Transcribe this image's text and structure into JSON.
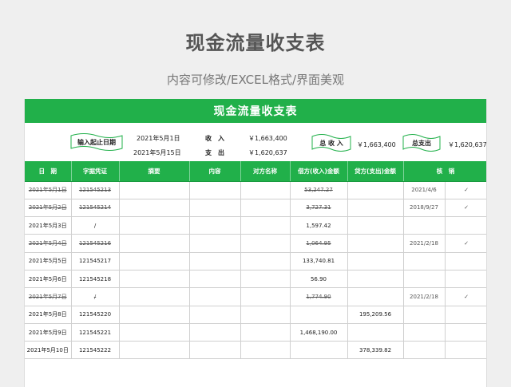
{
  "page": {
    "title": "现金流量收支表",
    "subtitle": "内容可修改/EXCEL格式/界面美观"
  },
  "sheet": {
    "title": "现金流量收支表",
    "summary": {
      "period_label": "输入起止日期",
      "start_date": "2021年5月1日",
      "end_date": "2021年5月15日",
      "income_label": "收　入",
      "expense_label": "支　出",
      "income_value": "￥1,663,400",
      "expense_value": "￥1,620,637",
      "total_income_label": "总 收 入",
      "total_income_value": "￥1,663,400",
      "total_expense_label": "总支出",
      "total_expense_value": "￥1,620,637"
    },
    "columns": [
      "日　期",
      "字据凭证",
      "摘要",
      "内容",
      "对方名称",
      "借方(收入)金额",
      "贷方(支出)金额",
      "核　销"
    ],
    "rows": [
      {
        "date": "2021年5月1日",
        "voucher": "121545213",
        "debit": "53,247.27",
        "credit": "",
        "verify_date": "2021/4/6",
        "check": "✓",
        "done": true
      },
      {
        "date": "2021年5月2日",
        "voucher": "121545214",
        "debit": "3,727.31",
        "credit": "",
        "verify_date": "2018/9/27",
        "check": "✓",
        "done": true
      },
      {
        "date": "2021年5月3日",
        "voucher": "/",
        "debit": "1,597.42",
        "credit": "",
        "verify_date": "",
        "check": "",
        "done": false
      },
      {
        "date": "2021年5月4日",
        "voucher": "121545216",
        "debit": "1,064.95",
        "credit": "",
        "verify_date": "2021/2/18",
        "check": "✓",
        "done": true
      },
      {
        "date": "2021年5月5日",
        "voucher": "121545217",
        "debit": "133,740.81",
        "credit": "",
        "verify_date": "",
        "check": "",
        "done": false
      },
      {
        "date": "2021年5月6日",
        "voucher": "121545218",
        "debit": "56.90",
        "credit": "",
        "verify_date": "",
        "check": "",
        "done": false
      },
      {
        "date": "2021年5月7日",
        "voucher": "/",
        "debit": "1,774.90",
        "credit": "",
        "verify_date": "2021/2/18",
        "check": "✓",
        "done": true
      },
      {
        "date": "2021年5月8日",
        "voucher": "121545220",
        "debit": "",
        "credit": "195,209.56",
        "verify_date": "",
        "check": "",
        "done": false
      },
      {
        "date": "2021年5月9日",
        "voucher": "121545221",
        "debit": "1,468,190.00",
        "credit": "",
        "verify_date": "",
        "check": "",
        "done": false
      },
      {
        "date": "2021年5月10日",
        "voucher": "121545222",
        "debit": "",
        "credit": "378,339.82",
        "verify_date": "",
        "check": "",
        "done": false
      }
    ]
  }
}
